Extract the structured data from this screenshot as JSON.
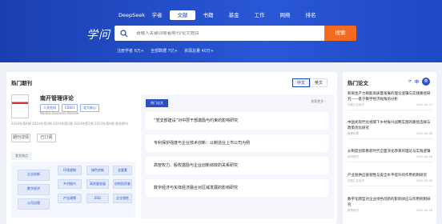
{
  "nav": [
    "DeepSeek",
    "学者",
    "文献",
    "书籍",
    "基金",
    "工作",
    "网络",
    "排名"
  ],
  "nav_active": 2,
  "logo": "学问",
  "search": {
    "placeholder": "请输入关键词或者期刊/论文题目",
    "button": "搜索"
  },
  "stats": [
    "注册学者 6万+",
    "全部数据 7亿+",
    "资源总量 40万+"
  ],
  "hot_journals": {
    "title": "热门期刊",
    "lang": [
      "中文",
      "英文"
    ],
    "journal": {
      "name": "南开管理评论",
      "tags": [
        "人文社科",
        "CSSCI",
        "北大核心"
      ],
      "en_name": "Nankai Business Review",
      "meta": "2024年第4期 2024年第3期 2024年第2期 2024年第1期 2023年第6期 更多期刊",
      "buttons": [
        "期刊详情",
        "已订阅"
      ]
    },
    "cat_label": "发文热点",
    "categories": [
      "企业创新",
      "数字经济",
      "公司治理",
      "环境规制",
      "乡村振兴",
      "产业政策",
      "绿色创新",
      "高质量发展",
      "ESG",
      "全要素",
      "机构投资者",
      "企业韧性"
    ],
    "featured": {
      "badge": "热门论文",
      "more": "查看更多 ›",
      "items": [
        "“党支部建设”对中层干部激励与约束的影响研究",
        "专利保护强度与企业技术创新：以制造业上市公司为例",
        "高管权力、股权激励与企业创新绩效的关系研究",
        "数字经济与实体经济融合对区域发展的影响研究"
      ]
    }
  },
  "hot_papers": {
    "title": "热门论文",
    "lang": [
      "中",
      "英"
    ],
    "items": [
      {
        "title": "新质生产力赋能高质量发展的理论逻辑与实践路径研究——基于数字经济视角的分析",
        "src": "中国工业经济",
        "date": "2024-05-12"
      },
      {
        "title": "中国式现代化视域下乡村振兴战略实施的路径选择与政策优化研究",
        "src": "管理世界",
        "date": "2024-04-28"
      },
      {
        "title": "从制度创新看新时代全面深化改革的理论与实践逻辑",
        "src": "经济研究",
        "date": "2024-04-16"
      },
      {
        "title": "产业链供应链韧性与安全水平提升的作用机制研究",
        "src": "中国工业经济",
        "date": "2024-03-30"
      },
      {
        "title": "数字化转型对企业绿色创新的影响效应与作用机制研究",
        "src": "财贸经济",
        "date": "2024-03-18"
      }
    ]
  }
}
